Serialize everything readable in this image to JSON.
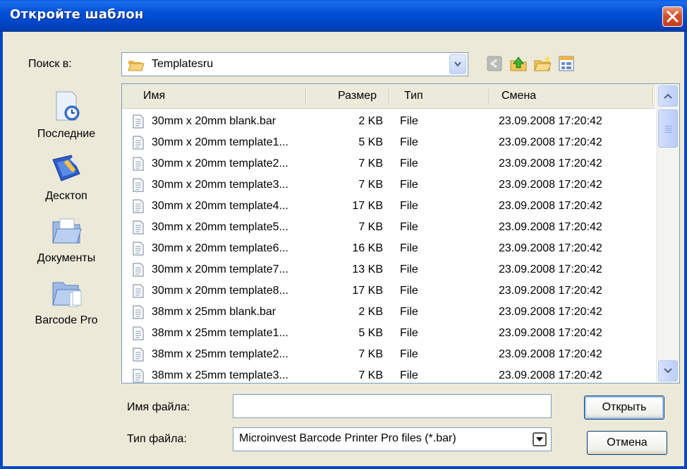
{
  "window": {
    "title": "Откройте шаблон"
  },
  "look_in": {
    "label": "Поиск в:",
    "folder": "Templatesru"
  },
  "toolbar": {
    "icons": [
      "back-icon",
      "up-folder-icon",
      "new-folder-icon",
      "view-menu-icon"
    ]
  },
  "places": [
    {
      "label": "Последние",
      "icon": "recent-icon"
    },
    {
      "label": "Десктоп",
      "icon": "desktop-icon"
    },
    {
      "label": "Документы",
      "icon": "documents-icon"
    },
    {
      "label": "Barcode Pro",
      "icon": "barcode-pro-folder-icon"
    }
  ],
  "columns": {
    "name": "Имя",
    "size": "Размер",
    "type": "Тип",
    "modified": "Смена"
  },
  "files": [
    {
      "name": "30mm x 20mm blank.bar",
      "size": "2 KB",
      "type": "File",
      "modified": "23.09.2008 17:20:42"
    },
    {
      "name": "30mm x 20mm template1...",
      "size": "5 KB",
      "type": "File",
      "modified": "23.09.2008 17:20:42"
    },
    {
      "name": "30mm x 20mm template2...",
      "size": "7 KB",
      "type": "File",
      "modified": "23.09.2008 17:20:42"
    },
    {
      "name": "30mm x 20mm template3...",
      "size": "7 KB",
      "type": "File",
      "modified": "23.09.2008 17:20:42"
    },
    {
      "name": "30mm x 20mm template4...",
      "size": "17 KB",
      "type": "File",
      "modified": "23.09.2008 17:20:42"
    },
    {
      "name": "30mm x 20mm template5...",
      "size": "7 KB",
      "type": "File",
      "modified": "23.09.2008 17:20:42"
    },
    {
      "name": "30mm x 20mm template6...",
      "size": "16 KB",
      "type": "File",
      "modified": "23.09.2008 17:20:42"
    },
    {
      "name": "30mm x 20mm template7...",
      "size": "13 KB",
      "type": "File",
      "modified": "23.09.2008 17:20:42"
    },
    {
      "name": "30mm x 20mm template8...",
      "size": "17 KB",
      "type": "File",
      "modified": "23.09.2008 17:20:42"
    },
    {
      "name": "38mm x 25mm blank.bar",
      "size": "2 KB",
      "type": "File",
      "modified": "23.09.2008 17:20:42"
    },
    {
      "name": "38mm x 25mm template1...",
      "size": "5 KB",
      "type": "File",
      "modified": "23.09.2008 17:20:42"
    },
    {
      "name": "38mm x 25mm template2...",
      "size": "7 KB",
      "type": "File",
      "modified": "23.09.2008 17:20:42"
    },
    {
      "name": "38mm x 25mm template3...",
      "size": "7 KB",
      "type": "File",
      "modified": "23.09.2008 17:20:42"
    }
  ],
  "file_name": {
    "label": "Имя файла:",
    "value": ""
  },
  "file_type": {
    "label": "Тип файла:",
    "value": "Microinvest Barcode Printer Pro files (*.bar)"
  },
  "buttons": {
    "open": "Открыть",
    "cancel": "Отмена"
  },
  "colors": {
    "titlebar": "#0047C8",
    "dialog_bg": "#ECE9D8",
    "close": "#D5512C"
  }
}
